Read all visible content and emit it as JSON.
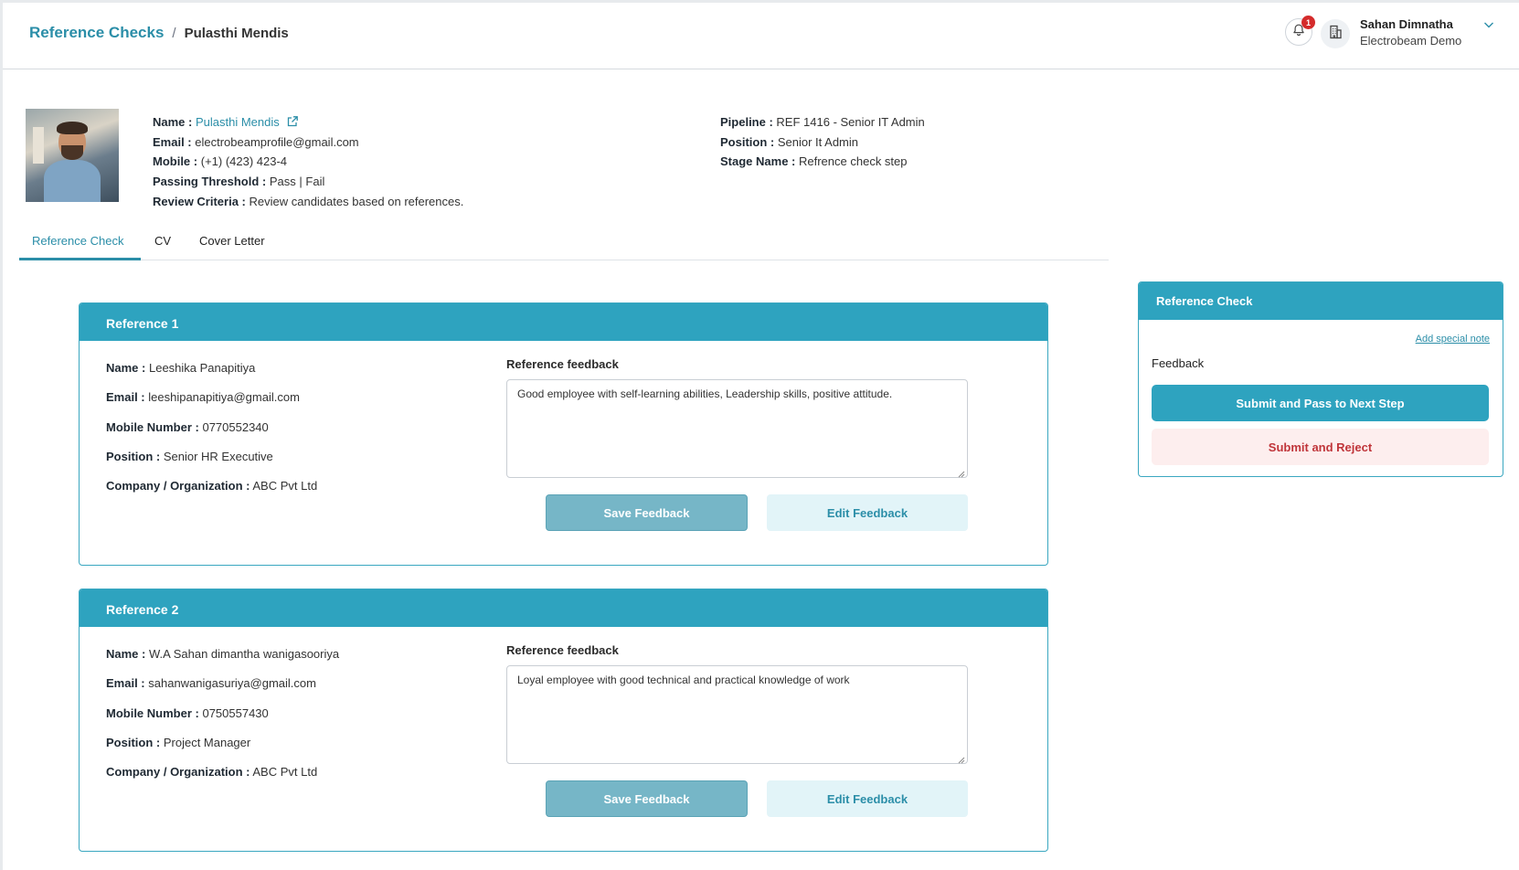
{
  "breadcrumb": {
    "root": "Reference Checks",
    "separator": "/",
    "current": "Pulasthi Mendis"
  },
  "header": {
    "notification_count": "1",
    "user_name": "Sahan Dimnatha",
    "user_org": "Electrobeam Demo",
    "icons": [
      "bell-icon",
      "building-icon",
      "chevron-down-icon"
    ]
  },
  "candidate": {
    "name_label": "Name :",
    "name": "Pulasthi Mendis",
    "email_label": "Email :",
    "email": "electrobeamprofile@gmail.com",
    "mobile_label": "Mobile :",
    "mobile": "(+1) (423) 423-4",
    "threshold_label": "Passing Threshold :",
    "threshold_pass": "Pass",
    "threshold_sep": "|",
    "threshold_fail": "Fail",
    "criteria_label": "Review Criteria :",
    "criteria": "Review candidates based on references.",
    "pipeline_label": "Pipeline :",
    "pipeline": "REF 1416 - Senior IT Admin",
    "position_label": "Position :",
    "position": "Senior It Admin",
    "stage_label": "Stage Name :",
    "stage": "Refrence check step"
  },
  "tabs": [
    {
      "label": "Reference Check",
      "active": true
    },
    {
      "label": "CV",
      "active": false
    },
    {
      "label": "Cover Letter",
      "active": false
    }
  ],
  "references": [
    {
      "title": "Reference 1",
      "name_label": "Name :",
      "name": "Leeshika Panapitiya",
      "email_label": "Email :",
      "email": "leeshipanapitiya@gmail.com",
      "mobile_label": "Mobile Number :",
      "mobile": "0770552340",
      "position_label": "Position :",
      "position": "Senior HR Executive",
      "company_label": "Company / Organization :",
      "company": "ABC Pvt Ltd",
      "feedback_label": "Reference feedback",
      "feedback": "Good employee with self-learning abilities, Leadership skills, positive attitude.",
      "save_label": "Save Feedback",
      "edit_label": "Edit Feedback"
    },
    {
      "title": "Reference 2",
      "name_label": "Name :",
      "name": "W.A Sahan dimantha wanigasooriya",
      "email_label": "Email :",
      "email": "sahanwanigasuriya@gmail.com",
      "mobile_label": "Mobile Number :",
      "mobile": "0750557430",
      "position_label": "Position :",
      "position": "Project Manager",
      "company_label": "Company / Organization :",
      "company": "ABC Pvt Ltd",
      "feedback_label": "Reference feedback",
      "feedback": "Loyal employee with good technical and practical knowledge of work",
      "save_label": "Save Feedback",
      "edit_label": "Edit Feedback"
    }
  ],
  "side_panel": {
    "title": "Reference Check",
    "add_note": "Add special note",
    "feedback_label": "Feedback",
    "pass_label": "Submit and Pass to Next Step",
    "reject_label": "Submit and Reject"
  },
  "colors": {
    "accent": "#2ea3bf",
    "link": "#2b8ea8",
    "reject": "#c0353a",
    "badge": "#d42b2b"
  }
}
